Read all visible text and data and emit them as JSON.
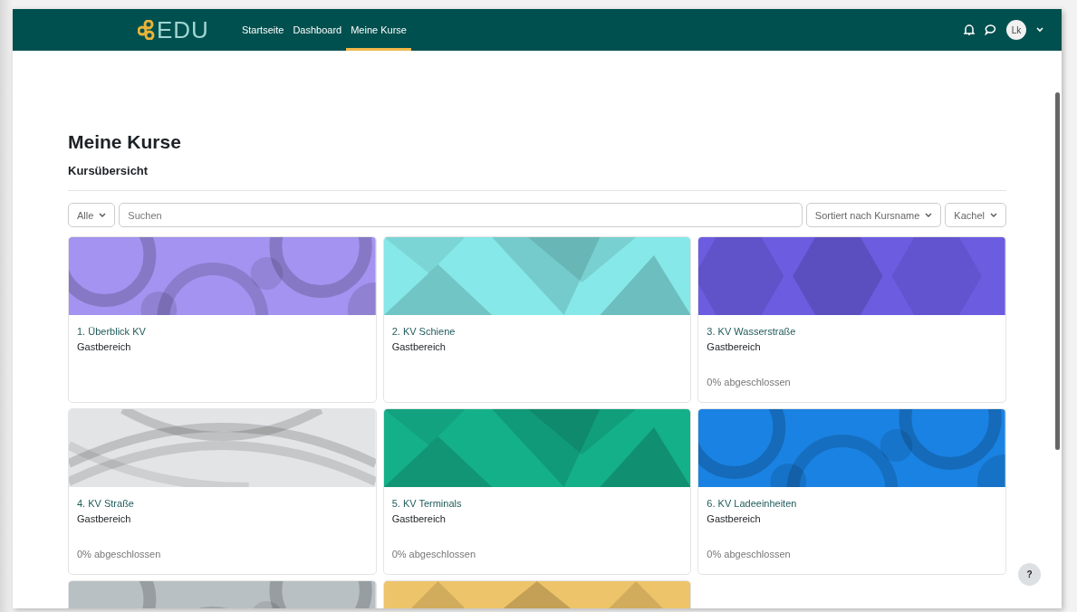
{
  "navbar": {
    "logo": "EDU",
    "links": [
      {
        "label": "Startseite",
        "selected": false
      },
      {
        "label": "Dashboard",
        "selected": false
      },
      {
        "label": "Meine Kurse",
        "selected": true
      }
    ],
    "avatar": "Lk"
  },
  "page": {
    "title": "Meine Kurse",
    "subtitle": "Kursübersicht"
  },
  "filters": {
    "grouping": "Alle",
    "search": {
      "placeholder": "Suchen"
    },
    "sort": "Sortiert nach Kursname",
    "view": "Kachel"
  },
  "courses": [
    {
      "name": "1. Überblick KV",
      "category": "Gastbereich",
      "color": "#a493f0"
    },
    {
      "name": "2. KV Schiene",
      "category": "Gastbereich",
      "color": "#86e8e8"
    },
    {
      "name": "3. KV Wasserstraße",
      "category": "Gastbereich",
      "progress": "0% abgeschlossen",
      "color": "#6b5ce0"
    },
    {
      "name": "4. KV Straße",
      "category": "Gastbereich",
      "progress": "0% abgeschlossen",
      "color": "#e2e4e6"
    },
    {
      "name": "5. KV Terminals",
      "category": "Gastbereich",
      "progress": "0% abgeschlossen",
      "color": "#14b08a"
    },
    {
      "name": "6. KV Ladeeinheiten",
      "category": "Gastbereich",
      "progress": "0% abgeschlossen",
      "color": "#1a82e2"
    },
    {
      "color": "#b9c0c4"
    },
    {
      "color": "#eec46a"
    }
  ],
  "help_button": "?"
}
